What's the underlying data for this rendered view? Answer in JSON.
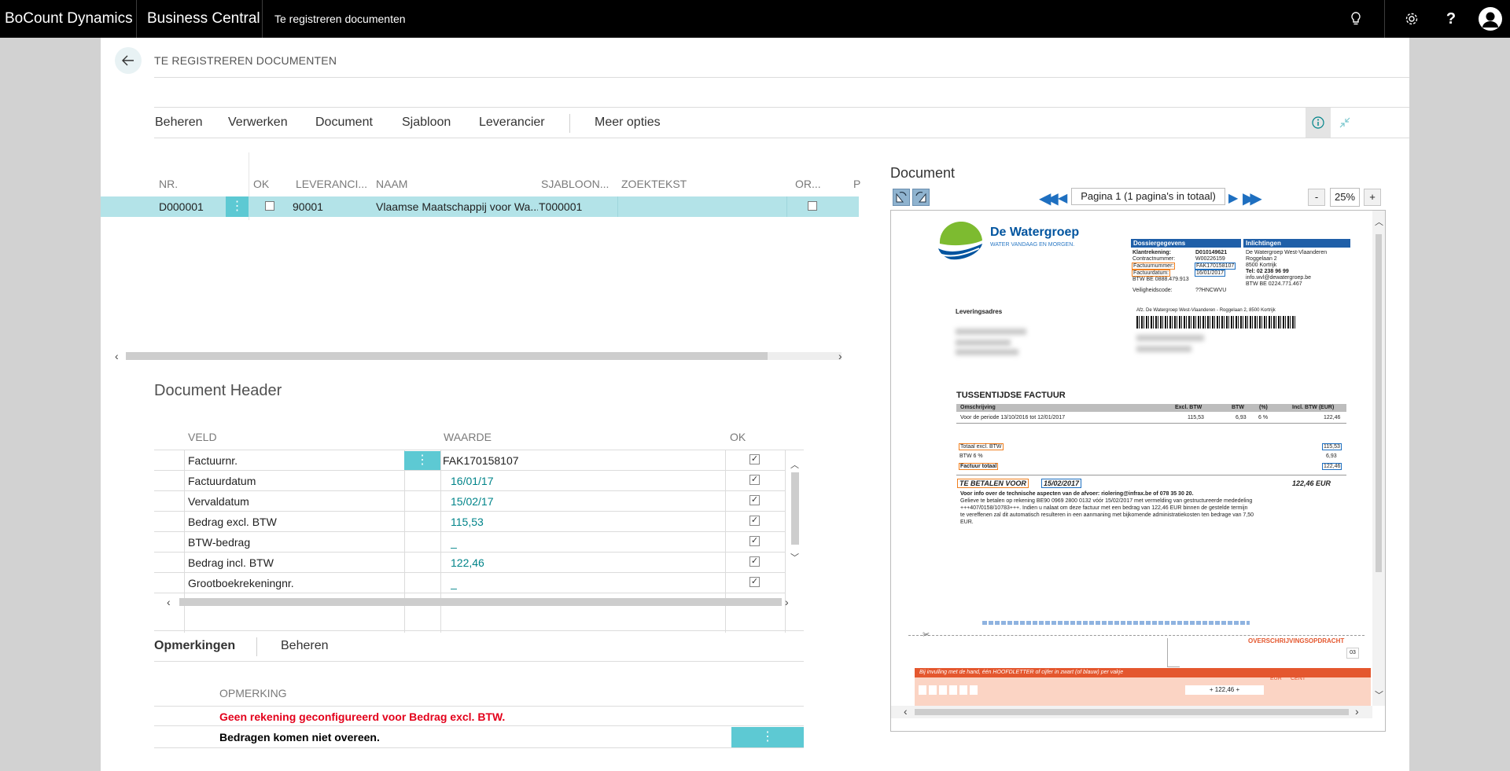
{
  "topbar": {
    "brand": "BoCount Dynamics",
    "product": "Business Central",
    "page": "Te registreren documenten",
    "icons": [
      "lightbulb-icon",
      "gear-icon",
      "help-icon",
      "user-icon"
    ],
    "help_glyph": "?"
  },
  "header": {
    "title": "TE REGISTREREN DOCUMENTEN"
  },
  "actions": {
    "items": [
      "Beheren",
      "Verwerken",
      "Document",
      "Sjabloon",
      "Leverancier"
    ],
    "more": "Meer opties"
  },
  "list": {
    "columns": [
      "NR.",
      "OK",
      "LEVERANCI...",
      "NAAM",
      "SJABLOON...",
      "ZOEKTEKST",
      "OR...",
      "P"
    ],
    "row": {
      "nr": "D000001",
      "ok": false,
      "leverancier": "90001",
      "naam": "Vlaamse Maatschappij voor Wa...",
      "sjabloon": "T000001",
      "zoektekst": "",
      "or": false
    },
    "menu_glyph": "⋮"
  },
  "doc_header": {
    "title": "Document Header",
    "columns": [
      "VELD",
      "WAARDE",
      "OK"
    ],
    "rows": [
      {
        "veld": "Factuurnr.",
        "waarde": "FAK170158107",
        "ok": true
      },
      {
        "veld": "Factuurdatum",
        "waarde": "16/01/17",
        "ok": true
      },
      {
        "veld": "Vervaldatum",
        "waarde": "15/02/17",
        "ok": true
      },
      {
        "veld": "Bedrag excl. BTW",
        "waarde": "115,53",
        "ok": true
      },
      {
        "veld": "BTW-bedrag",
        "waarde": "_",
        "ok": true
      },
      {
        "veld": "Bedrag incl. BTW",
        "waarde": "122,46",
        "ok": true
      },
      {
        "veld": "Grootboekrekeningnr.",
        "waarde": "_",
        "ok": true
      }
    ]
  },
  "remarks": {
    "tabs": [
      "Opmerkingen",
      "Beheren"
    ],
    "column": "OPMERKING",
    "rows": [
      {
        "text": "Geen rekening geconfigureerd voor Bedrag excl. BTW.",
        "color": "#e3001b"
      },
      {
        "text": "Bedragen komen niet overeen.",
        "color": "#000000"
      }
    ]
  },
  "viewer": {
    "title": "Document",
    "page_label": "Pagina 1 (1 pagina's in totaal)",
    "zoom": "25%",
    "zoom_minus": "-",
    "zoom_plus": "+"
  },
  "invoice": {
    "logo_name": "De Watergroep",
    "logo_tagline": "WATER VANDAAG EN MORGEN.",
    "box1_title": "Dossiergegevens",
    "box2_title": "Inlichtingen",
    "klant_label": "Klantrekening:",
    "klant_value": "D010149621",
    "contract_label": "Contractnummer:",
    "contract_value": "W00226159",
    "fact_label": "Factuurnummer:",
    "fact_value": "FAK170158107",
    "datum_label": "Factuurdatum:",
    "datum_value": "16/01/2017",
    "btw_label": "BTW BE 0888.479.913",
    "veil_label": "Veiligheidscode:",
    "veil_value": "??HNCWVU",
    "info_lines": [
      "De Watergroep West-Vlaanderen",
      "Roggelaan 2",
      "8500 Kortrijk",
      "Tel: 02 238 96 99",
      "info.wvl@dewatergroep.be",
      "BTW BE 0224.771.467"
    ],
    "levering": "Leveringsadres",
    "afz": "Afz. De Watergroep West-Vlaanderen - Roggelaan 2, 8500 Kortrijk",
    "heading": "TUSSENTIJDSE FACTUUR",
    "tbl_cols": [
      "Omschrijving",
      "Excl. BTW",
      "BTW",
      "(%)",
      "Incl. BTW (EUR)"
    ],
    "tbl_row": [
      "Voor de periode 13/10/2016 tot 12/01/2017",
      "115,53",
      "6,93",
      "6 %",
      "122,46"
    ],
    "tot_excl_label": "Totaal excl. BTW",
    "tot_excl": "115,53",
    "btw6_label": "BTW 6 %",
    "btw6": "6,93",
    "fact_tot_label": "Factuur totaal",
    "fact_tot": "122,46",
    "pay_label": "TE BETALEN VOOR",
    "pay_date": "15/02/2017",
    "pay_amount": "122,46 EUR",
    "note_bold": "Voor info over de technische aspecten van de afvoer: riolering@infrax.be of 078 35 30 20.",
    "note_lines": [
      "Gelieve te betalen op rekening BE90 0969 2800 0132 vóór 15/02/2017 met vermelding van gestructureerde mededeling",
      "+++407/0158/10783+++. Indien u nalaat om deze factuur met een bedrag van 122,46 EUR binnen de gestelde termijn",
      "te vereffenen zal dit automatisch resulteren in een aanmaning met bijkomende administratiekosten ten bedrage van 7,50",
      "EUR."
    ],
    "transfer": "OVERSCHRIJVINGSOPDRACHT",
    "transfer_num": "03",
    "orange_text": "Bij invulling met de hand, één HOOFDLETTER of cijfer in zwart (of blauw) per vakje",
    "eur": "EUR",
    "cent": "CENT",
    "amount_field": "+ 122,46 +"
  }
}
